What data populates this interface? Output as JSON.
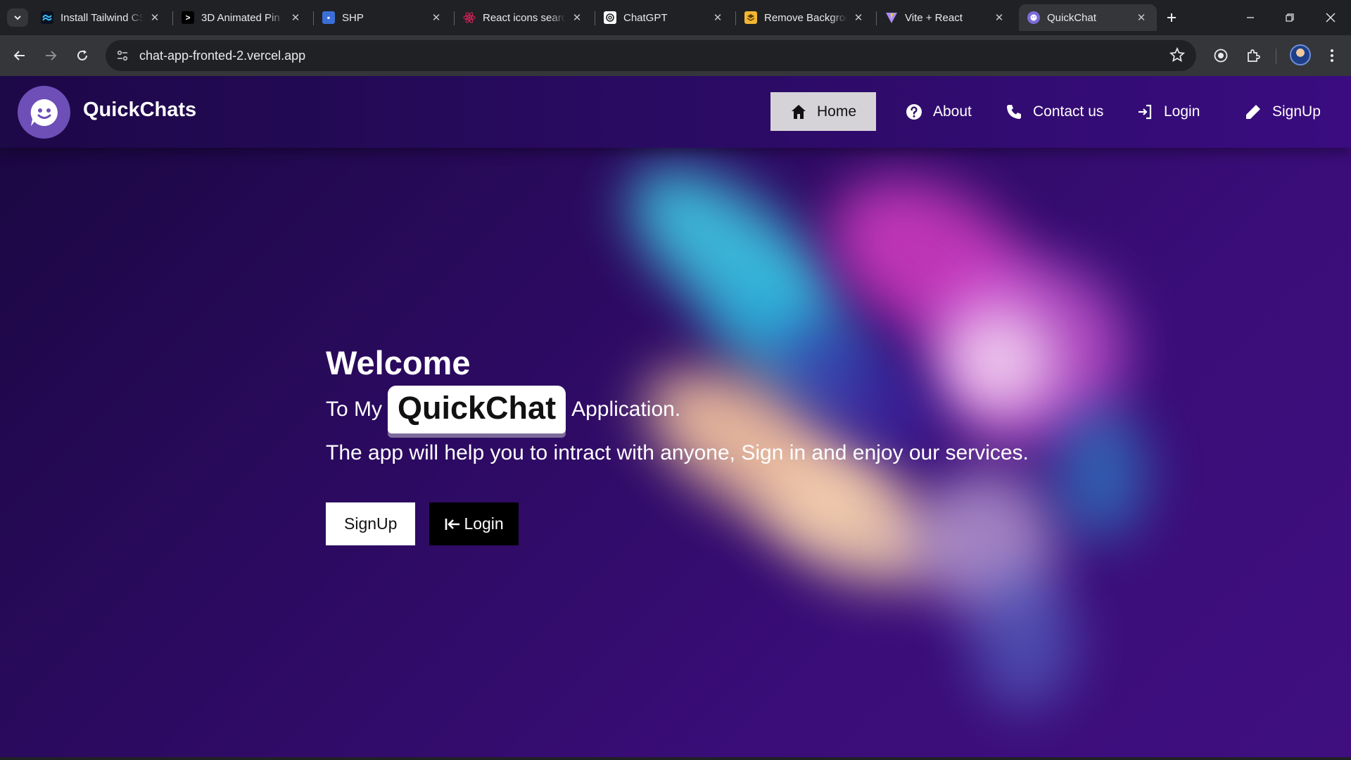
{
  "browser": {
    "tabs": [
      {
        "title": "Install Tailwind CSS",
        "favicon": "tailwind-icon",
        "active": false
      },
      {
        "title": "3D Animated Pin",
        "favicon": "chevron-right-icon",
        "active": false
      },
      {
        "title": "SHP",
        "favicon": "profile-card-icon",
        "active": false
      },
      {
        "title": "React icons search",
        "favicon": "react-icon",
        "active": false
      },
      {
        "title": "ChatGPT",
        "favicon": "openai-icon",
        "active": false
      },
      {
        "title": "Remove Background",
        "favicon": "remove-bg-icon",
        "active": false
      },
      {
        "title": "Vite + React",
        "favicon": "vite-icon",
        "active": false
      },
      {
        "title": "QuickChat",
        "favicon": "quickchat-icon",
        "active": true
      }
    ],
    "url": "chat-app-fronted-2.vercel.app"
  },
  "header": {
    "brand": "QuickChats",
    "nav": [
      {
        "label": "Home",
        "icon": "home-icon",
        "active": true
      },
      {
        "label": "About",
        "icon": "question-circle-icon",
        "active": false
      },
      {
        "label": "Contact us",
        "icon": "phone-icon",
        "active": false
      },
      {
        "label": "Login",
        "icon": "login-icon",
        "active": false
      },
      {
        "label": "SignUp",
        "icon": "pencil-icon",
        "active": false
      }
    ]
  },
  "hero": {
    "title": "Welcome",
    "line2_prefix": "To My",
    "brand_chip": "QuickChat",
    "line2_suffix": "Application.",
    "description": "The app will help you to intract with anyone, Sign in and enjoy our services.",
    "signup_label": "SignUp",
    "login_label": "Login"
  },
  "colors": {
    "page_bg": "#2a0a5e",
    "header_bg": "#2a0b63",
    "active_nav_bg": "#d6d3d8",
    "logo_bg": "#6e4fb8"
  }
}
